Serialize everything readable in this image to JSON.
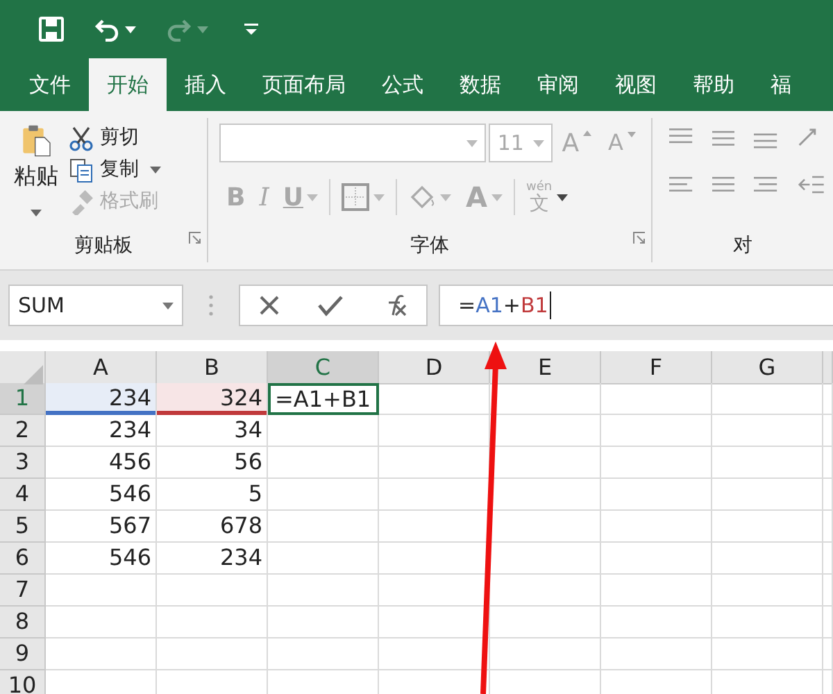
{
  "quick_access": [
    {
      "kind": "save",
      "disabled": false
    },
    {
      "kind": "undo",
      "disabled": false
    },
    {
      "kind": "redo",
      "disabled": true
    },
    {
      "kind": "customize",
      "disabled": false
    }
  ],
  "tabs": [
    {
      "label": "文件",
      "selected": false
    },
    {
      "label": "开始",
      "selected": true
    },
    {
      "label": "插入",
      "selected": false
    },
    {
      "label": "页面布局",
      "selected": false
    },
    {
      "label": "公式",
      "selected": false
    },
    {
      "label": "数据",
      "selected": false
    },
    {
      "label": "审阅",
      "selected": false
    },
    {
      "label": "视图",
      "selected": false
    },
    {
      "label": "帮助",
      "selected": false
    },
    {
      "label": "福",
      "selected": false
    }
  ],
  "clipboard": {
    "paste": "粘贴",
    "label": "剪贴板",
    "items": [
      {
        "kind": "cut",
        "label": "剪切",
        "disabled": false,
        "dropdown": false
      },
      {
        "kind": "copy",
        "label": "复制",
        "disabled": false,
        "dropdown": true
      },
      {
        "kind": "painter",
        "label": "格式刷",
        "disabled": true,
        "dropdown": false
      }
    ]
  },
  "font": {
    "label": "字体",
    "disabled": true,
    "size": "11",
    "grow": "A",
    "shrink": "A",
    "bold": "B",
    "italic": "I",
    "underline": "U",
    "font_color": "A",
    "phonetic_top": "wén",
    "phonetic_bottom": "文"
  },
  "alignment": {
    "label": "对"
  },
  "name_box": {
    "value": "SUM"
  },
  "formula": [
    {
      "text": "=",
      "color": "#222222"
    },
    {
      "text": "A1",
      "color": "#4472c4"
    },
    {
      "text": "+",
      "color": "#222222"
    },
    {
      "text": "B1",
      "color": "#c0393b"
    }
  ],
  "columns": [
    {
      "label": "A",
      "selected": false
    },
    {
      "label": "B",
      "selected": false
    },
    {
      "label": "C",
      "selected": true
    },
    {
      "label": "D",
      "selected": false
    },
    {
      "label": "E",
      "selected": false
    },
    {
      "label": "F",
      "selected": false
    },
    {
      "label": "G",
      "selected": false
    }
  ],
  "rows": [
    {
      "label": "1",
      "selected": true,
      "cells": [
        {
          "text": "234",
          "kind": "number",
          "color": "#4472c4"
        },
        {
          "text": "324",
          "kind": "number",
          "color": "#c0393b"
        },
        {
          "text": "=A1+B1",
          "kind": "text",
          "active": true
        }
      ]
    },
    {
      "label": "2",
      "selected": false,
      "cells": [
        {
          "text": "234",
          "kind": "number"
        },
        {
          "text": "34",
          "kind": "number"
        }
      ]
    },
    {
      "label": "3",
      "selected": false,
      "cells": [
        {
          "text": "456",
          "kind": "number"
        },
        {
          "text": "56",
          "kind": "number"
        }
      ]
    },
    {
      "label": "4",
      "selected": false,
      "cells": [
        {
          "text": "546",
          "kind": "number"
        },
        {
          "text": "5",
          "kind": "number"
        }
      ]
    },
    {
      "label": "5",
      "selected": false,
      "cells": [
        {
          "text": "567",
          "kind": "number"
        },
        {
          "text": "678",
          "kind": "number"
        }
      ]
    },
    {
      "label": "6",
      "selected": false,
      "cells": [
        {
          "text": "546",
          "kind": "number"
        },
        {
          "text": "234",
          "kind": "number"
        }
      ]
    },
    {
      "label": "7",
      "selected": false,
      "cells": []
    },
    {
      "label": "8",
      "selected": false,
      "cells": []
    },
    {
      "label": "9",
      "selected": false,
      "cells": []
    },
    {
      "label": "10",
      "selected": false,
      "cells": []
    }
  ]
}
